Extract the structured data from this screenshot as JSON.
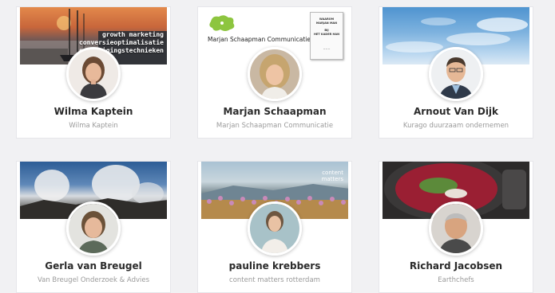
{
  "cards": [
    {
      "name": "Wilma Kaptein",
      "subtitle": "Wilma Kaptein",
      "cover_text": [
        "growth marketing",
        "conversieoptimalisatie",
        "overtuigingstechnieken"
      ]
    },
    {
      "name": "Marjan Schaapman",
      "subtitle": "Marjan Schaapman Communicatie",
      "cover_text": [
        "Marjan Schaapman Communicatie"
      ]
    },
    {
      "name": "Arnout Van Dijk",
      "subtitle": "Kurago duurzaam ondernemen"
    },
    {
      "name": "Gerla van Breugel",
      "subtitle": "Van Breugel Onderzoek & Advies"
    },
    {
      "name": "pauline krebbers",
      "subtitle": "content matters rotterdam",
      "cover_text": [
        "content",
        "matters"
      ]
    },
    {
      "name": "Richard Jacobsen",
      "subtitle": "Earthchefs"
    }
  ],
  "colors": {
    "page_bg": "#f1f1f3",
    "card_bg": "#ffffff",
    "name_text": "#2b2b2b",
    "subtitle_text": "#9a9a9a"
  }
}
